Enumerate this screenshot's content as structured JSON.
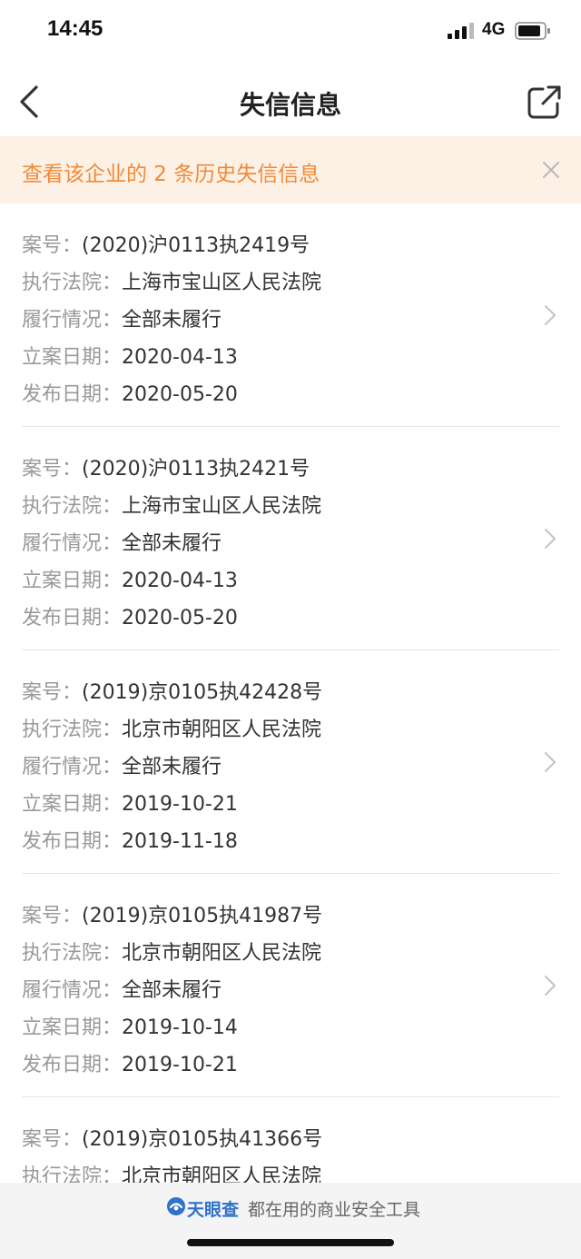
{
  "status_bar": {
    "time": "14:45",
    "network": "4G"
  },
  "nav": {
    "title": "失信信息"
  },
  "notice": {
    "text": "查看该企业的 2 条历史失信信息"
  },
  "labels": {
    "case_no": "案号：",
    "court": "执行法院：",
    "status": "履行情况：",
    "filed": "立案日期：",
    "published": "发布日期："
  },
  "records": [
    {
      "case_no": "(2020)沪0113执2419号",
      "court": "上海市宝山区人民法院",
      "status": "全部未履行",
      "filed": "2020-04-13",
      "published": "2020-05-20"
    },
    {
      "case_no": "(2020)沪0113执2421号",
      "court": "上海市宝山区人民法院",
      "status": "全部未履行",
      "filed": "2020-04-13",
      "published": "2020-05-20"
    },
    {
      "case_no": "(2019)京0105执42428号",
      "court": "北京市朝阳区人民法院",
      "status": "全部未履行",
      "filed": "2019-10-21",
      "published": "2019-11-18"
    },
    {
      "case_no": "(2019)京0105执41987号",
      "court": "北京市朝阳区人民法院",
      "status": "全部未履行",
      "filed": "2019-10-14",
      "published": "2019-10-21"
    },
    {
      "case_no": "(2019)京0105执41366号",
      "court": "北京市朝阳区人民法院"
    }
  ],
  "footer": {
    "brand": "天眼查",
    "slogan": "都在用的商业安全工具"
  },
  "colors": {
    "accent": "#f08a38",
    "notice_bg": "#fdf1e6",
    "brand": "#2f73c8"
  },
  "icons": {
    "back": "chevron-left-icon",
    "share": "share-icon",
    "close": "close-icon",
    "row": "chevron-right-icon"
  }
}
